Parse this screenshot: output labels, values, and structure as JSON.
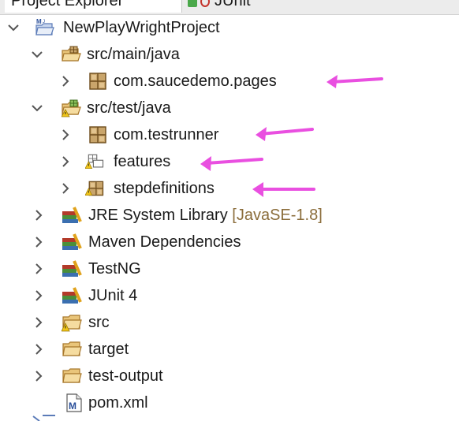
{
  "tabs": [
    {
      "label": "Project Explorer"
    },
    {
      "label": "JUnit"
    }
  ],
  "tree": {
    "project": {
      "label": "NewPlayWrightProject",
      "icon": "maven-project-icon"
    },
    "src_main": {
      "label": "src/main/java",
      "icon": "source-folder-icon"
    },
    "pkg_pages": {
      "label": "com.saucedemo.pages",
      "icon": "package-icon"
    },
    "src_test": {
      "label": "src/test/java",
      "icon": "source-folder-warning-icon"
    },
    "pkg_runner": {
      "label": "com.testrunner",
      "icon": "package-icon"
    },
    "pkg_features": {
      "label": "features",
      "icon": "empty-package-warning-icon"
    },
    "pkg_steps": {
      "label": "stepdefinitions",
      "icon": "package-warning-icon"
    },
    "jre": {
      "label": "JRE System Library",
      "decoration": "[JavaSE-1.8]",
      "icon": "library-icon"
    },
    "maven": {
      "label": "Maven Dependencies",
      "icon": "library-icon"
    },
    "testng": {
      "label": "TestNG",
      "icon": "library-icon"
    },
    "junit": {
      "label": "JUnit 4",
      "icon": "library-icon"
    },
    "src": {
      "label": "src",
      "icon": "folder-warning-icon"
    },
    "target": {
      "label": "target",
      "icon": "folder-icon"
    },
    "test_output": {
      "label": "test-output",
      "icon": "folder-icon"
    },
    "pom": {
      "label": "pom.xml",
      "icon": "maven-file-icon"
    }
  },
  "annotation_color": "#e94fe0"
}
